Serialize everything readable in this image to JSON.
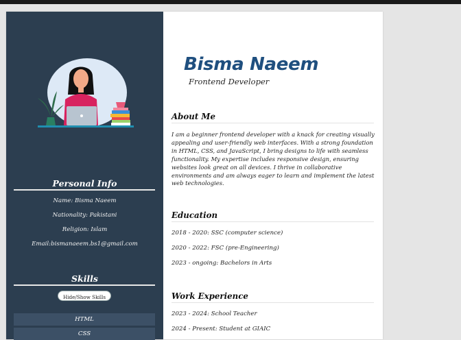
{
  "profile": {
    "name": "Bisma Naeem",
    "role": "Frontend Developer"
  },
  "personal_info": {
    "title": "Personal Info",
    "lines": [
      "Name: Bisma Naeem",
      "Nationality: Pakistani",
      "Religion: Islam",
      "Email:bismanaeem.bs1@gmail.com"
    ]
  },
  "skills": {
    "title": "Skills",
    "toggle_label": "Hide/Show Skills",
    "items": [
      "HTML",
      "CSS"
    ]
  },
  "about": {
    "title": "About Me",
    "text": "I am a beginner frontend developer with a knack for creating visually appealing and user-friendly web interfaces. With a strong foundation in HTML, CSS, and JavaScript, I bring designs to life with seamless functionality. My expertise includes responsive design, ensuring websites look great on all devices. I thrive in collaborative environments and am always eager to learn and implement the latest web technologies."
  },
  "education": {
    "title": "Education",
    "items": [
      "2018 - 2020: SSC (computer science)",
      "2020 - 2022: FSC (pre-Engineering)",
      "2023 - ongoing: Bachelors in Arts"
    ]
  },
  "work": {
    "title": "Work Experience",
    "items": [
      "2023 - 2024: School Teacher",
      "2024 - Present: Student at GIAIC"
    ]
  },
  "colors": {
    "sidebar": "#2c3e50",
    "name_accent": "#1f4f7f",
    "skill_bar": "#3c5066"
  },
  "icons": [
    "avatar-illustration"
  ]
}
